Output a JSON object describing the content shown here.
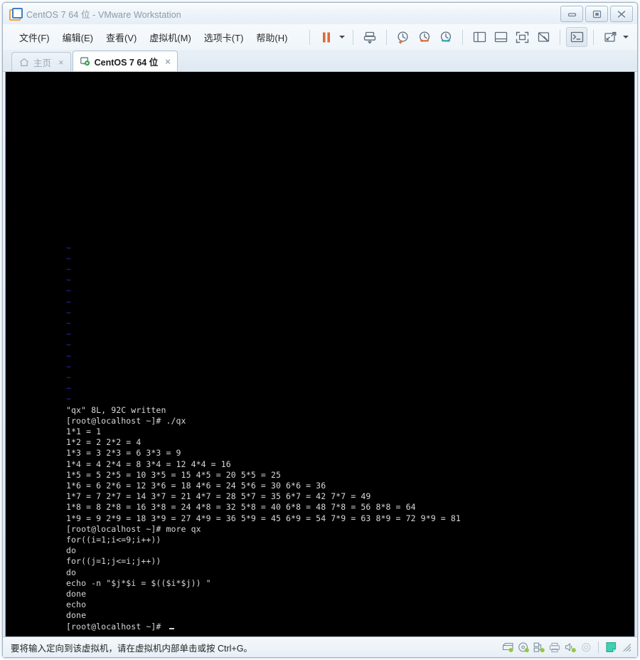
{
  "window": {
    "title": "CentOS 7 64 位 - VMware Workstation",
    "logo_icon": "vmware-logo-icon",
    "controls": [
      {
        "name": "minimize-button",
        "icon": "minimize-icon"
      },
      {
        "name": "restore-button",
        "icon": "restore-icon"
      },
      {
        "name": "close-button",
        "icon": "close-icon"
      }
    ]
  },
  "menubar": {
    "items": [
      {
        "label": "文件(F)",
        "name": "menu-file"
      },
      {
        "label": "编辑(E)",
        "name": "menu-edit"
      },
      {
        "label": "查看(V)",
        "name": "menu-view"
      },
      {
        "label": "虚拟机(M)",
        "name": "menu-vm"
      },
      {
        "label": "选项卡(T)",
        "name": "menu-tabs"
      },
      {
        "label": "帮助(H)",
        "name": "menu-help"
      }
    ]
  },
  "toolbar": {
    "buttons": [
      {
        "name": "suspend-button",
        "icon": "pause-icon",
        "color": "#e06a35"
      },
      {
        "name": "power-dropdown-button",
        "icon": "chevron-down-icon"
      },
      {
        "name": "send-ctrl-alt-del-button",
        "icon": "keyboard-send-icon"
      },
      {
        "name": "snapshot-button",
        "icon": "snapshot-clock-icon"
      },
      {
        "name": "revert-snapshot-button",
        "icon": "revert-snapshot-icon"
      },
      {
        "name": "snapshot-manager-button",
        "icon": "snapshot-manager-icon"
      },
      {
        "name": "show-library-button",
        "icon": "panel-left-icon"
      },
      {
        "name": "show-thumbnail-bar-button",
        "icon": "panel-bottom-icon"
      },
      {
        "name": "fullscreen-button",
        "icon": "fullscreen-icon"
      },
      {
        "name": "unity-mode-button",
        "icon": "unity-mode-icon"
      },
      {
        "name": "console-view-button",
        "icon": "console-prompt-icon"
      },
      {
        "name": "fit-window-button",
        "icon": "fit-window-icon"
      },
      {
        "name": "fit-window-dropdown",
        "icon": "chevron-down-icon"
      }
    ]
  },
  "tabs": [
    {
      "label": "主页",
      "name": "tab-home",
      "icon": "home-icon",
      "active": false,
      "close_label": "×"
    },
    {
      "label": "CentOS 7 64 位",
      "name": "tab-centos",
      "icon": "vm-play-icon",
      "active": true,
      "close_label": "×"
    }
  ],
  "terminal": {
    "vim_tilde": "~",
    "tilde_count": 15,
    "lines": [
      "\"qx\" 8L, 92C written",
      "[root@localhost ~]# ./qx",
      "1*1 = 1",
      "1*2 = 2 2*2 = 4",
      "1*3 = 3 2*3 = 6 3*3 = 9",
      "1*4 = 4 2*4 = 8 3*4 = 12 4*4 = 16",
      "1*5 = 5 2*5 = 10 3*5 = 15 4*5 = 20 5*5 = 25",
      "1*6 = 6 2*6 = 12 3*6 = 18 4*6 = 24 5*6 = 30 6*6 = 36",
      "1*7 = 7 2*7 = 14 3*7 = 21 4*7 = 28 5*7 = 35 6*7 = 42 7*7 = 49",
      "1*8 = 8 2*8 = 16 3*8 = 24 4*8 = 32 5*8 = 40 6*8 = 48 7*8 = 56 8*8 = 64",
      "1*9 = 9 2*9 = 18 3*9 = 27 4*9 = 36 5*9 = 45 6*9 = 54 7*9 = 63 8*9 = 72 9*9 = 81",
      "[root@localhost ~]# more qx",
      "for((i=1;i<=9;i++))",
      "do",
      "for((j=1;j<=i;j++))",
      "do",
      "echo -n \"$j*$i = $(($i*$j)) \"",
      "done",
      "echo",
      "done",
      "[root@localhost ~]# "
    ],
    "text_color": "#d8d8d8",
    "background_color": "#000000",
    "tilde_color": "#2b2ba8"
  },
  "statusbar": {
    "message": "要将输入定向到该虚拟机，请在虚拟机内部单击或按 Ctrl+G。",
    "icons": [
      {
        "name": "hard-disk-status-icon",
        "icon": "harddisk-icon"
      },
      {
        "name": "cd-dvd-status-icon",
        "icon": "cd-icon"
      },
      {
        "name": "network-status-icon",
        "icon": "network-icon"
      },
      {
        "name": "printer-status-icon",
        "icon": "printer-icon"
      },
      {
        "name": "sound-status-icon",
        "icon": "speaker-icon"
      },
      {
        "name": "usb-status-icon",
        "icon": "usb-icon"
      },
      {
        "name": "message-log-icon",
        "icon": "note-icon"
      }
    ],
    "resize_grip": "resize-grip-icon"
  }
}
